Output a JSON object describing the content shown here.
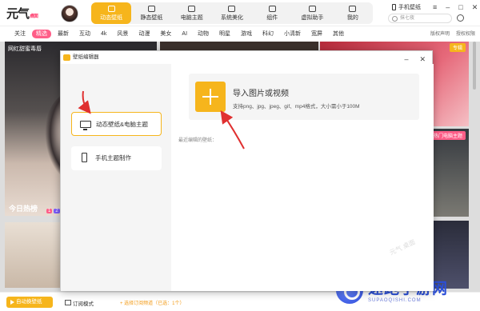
{
  "app": {
    "logo": "元气",
    "logo_sub": "桌面",
    "phone_wallpaper": "手机壁纸",
    "search_placeholder": "抹七夜"
  },
  "nav": {
    "tabs": [
      {
        "label": "动态壁纸",
        "active": true
      },
      {
        "label": "静态壁纸"
      },
      {
        "label": "电脑主题"
      },
      {
        "label": "系统美化"
      },
      {
        "label": "组件"
      },
      {
        "label": "虚拟助手"
      },
      {
        "label": "我的"
      }
    ]
  },
  "categories": [
    "关注",
    "精选",
    "最新",
    "互动",
    "4k",
    "风景",
    "动漫",
    "美女",
    "AI",
    "动物",
    "明星",
    "游戏",
    "科幻",
    "小清新",
    "宽屏",
    "其他"
  ],
  "category_active": "精选",
  "category_right": [
    "版权声明",
    "授权权限"
  ],
  "tiles": {
    "t1_label": "网红甜蜜毒唇",
    "t1_bottom": "今日热榜",
    "t1_badge1": "1",
    "t1_badge2": "2",
    "t3_tag": "专辑",
    "t4_tag": "热门电脑主题"
  },
  "footer": {
    "auto_button": "自动换壁纸",
    "mode": "订阅模式",
    "subscribe": "+ 选择订阅频道（已选：1个）"
  },
  "dialog": {
    "title": "壁纸编辑器",
    "menu": [
      "动态壁纸&电脑主题",
      "手机主题制作"
    ],
    "upload_title": "导入图片或视频",
    "upload_desc": "支持png、jpg、jpeg、gif、mp4格式，大小需小于100M",
    "recent": "最近编辑的壁纸：",
    "watermark": "元气 桌面"
  },
  "watermark": {
    "big": "速跑手游网",
    "small": "SUPAOQISHI.COM"
  },
  "colors": {
    "accent": "#f6b51c",
    "pink": "#ff5e88",
    "arrow": "#e03030"
  }
}
